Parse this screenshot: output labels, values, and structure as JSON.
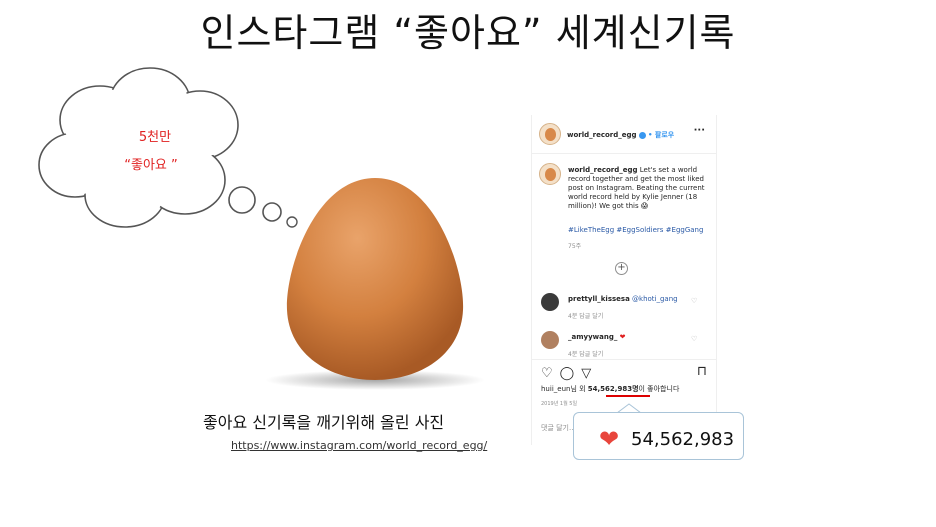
{
  "title": "인스타그램 “좋아요” 세계신기록",
  "cloud": {
    "line1": "5천만",
    "line2": "“좋아요 ”"
  },
  "photo": {
    "caption": "좋아요 신기록을 깨기위해 올린 사진",
    "link": "https://www.instagram.com/world_record_egg/"
  },
  "post": {
    "username": "world_record_egg",
    "follow": "• 팔로우",
    "more": "···",
    "caption_user": "world_record_egg",
    "caption_text": "Let's set a world record together and get the most liked post on Instagram. Beating the current world record held by Kylie Jenner (18 million)! We got this 😱",
    "hashtags": "#LikeTheEgg #EggSoldiers #EggGang",
    "posted_weeks": "75주",
    "add_icon": "+",
    "comments": [
      {
        "user": "prettyll_kissesa",
        "text": "@khoti_gang",
        "meta": "4분   답글 달기",
        "avatar_color": "#3a3a3a"
      },
      {
        "user": "_amyywang_",
        "text": "❤",
        "meta": "4분   답글 달기",
        "avatar_color": "#b08060"
      }
    ],
    "likes_prefix": "huii_eun님 외 ",
    "likes_count": "54,562,983명",
    "likes_suffix": "이 좋아합니다",
    "date": "2019년 1월 5일",
    "add_comment_placeholder": "댓글 달기..."
  },
  "callout": {
    "count": "54,562,983"
  },
  "colors": {
    "accent_red": "#e8453c",
    "link_blue": "#3897f0",
    "hashtag_blue": "#2b5aa6"
  },
  "icons": [
    "heart-icon",
    "comment-icon",
    "share-icon",
    "bookmark-icon",
    "verified-icon",
    "plus-circle-icon"
  ]
}
